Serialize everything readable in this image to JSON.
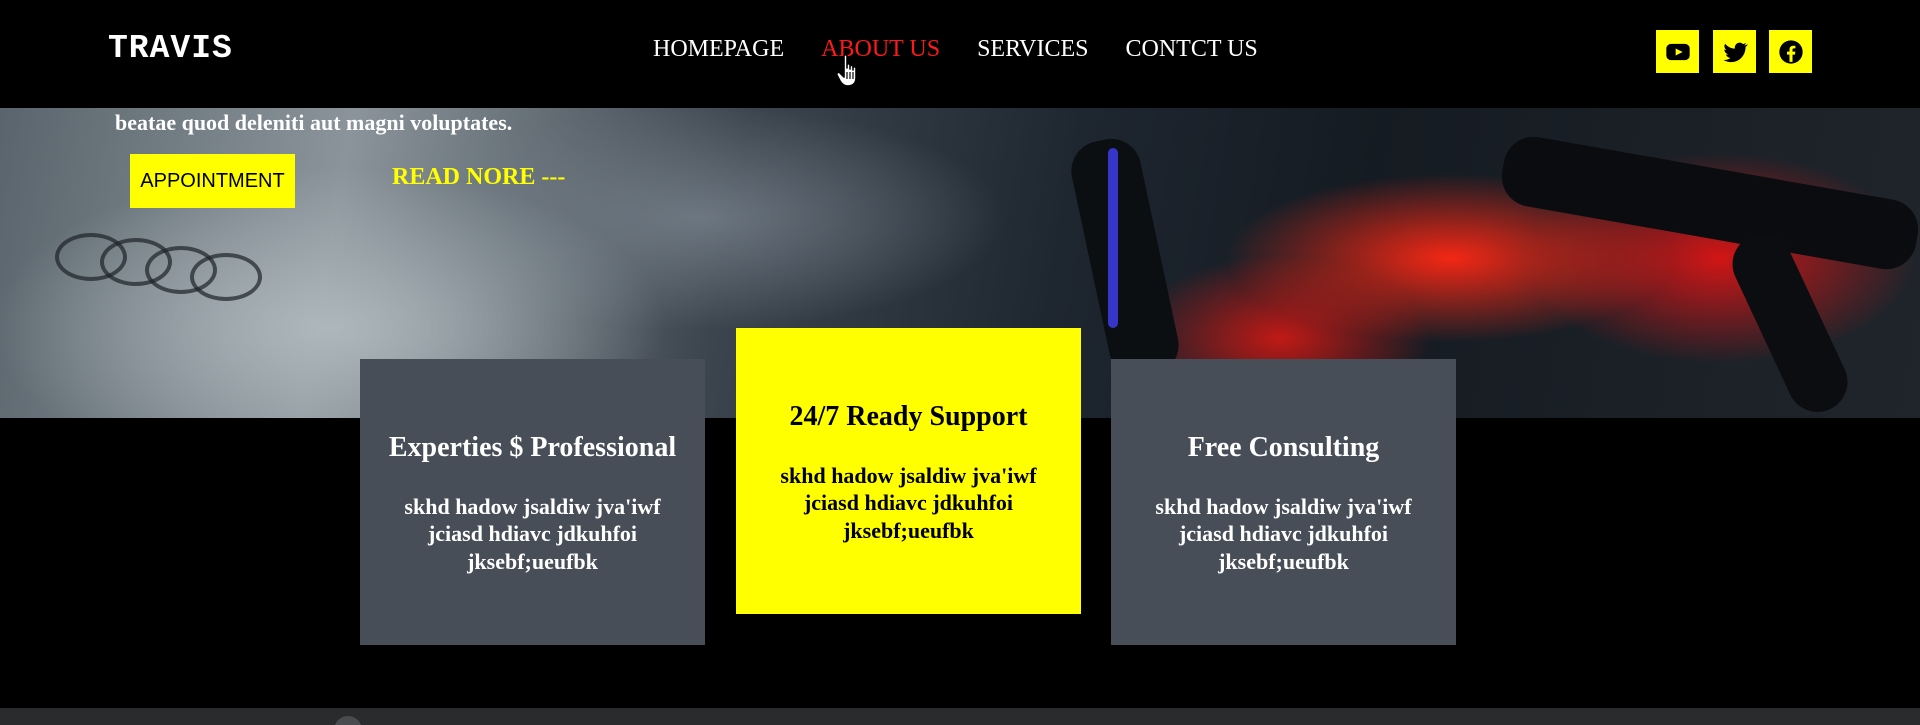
{
  "brand": {
    "logo": "TRAVIS"
  },
  "nav": {
    "items": [
      {
        "label": "HOMEPAGE",
        "active": false
      },
      {
        "label": "ABOUT US",
        "active": true
      },
      {
        "label": "SERVICES",
        "active": false
      },
      {
        "label": "CONTCT US",
        "active": false
      }
    ]
  },
  "social": [
    {
      "icon": "youtube-icon"
    },
    {
      "icon": "twitter-icon"
    },
    {
      "icon": "facebook-icon"
    }
  ],
  "hero": {
    "text": "beatae quod deleniti aut magni voluptates.",
    "appointment_label": "APPOINTMENT",
    "read_more_label": "READ NORE ---"
  },
  "cards": [
    {
      "title": "Experties $ Professional",
      "body": "skhd hadow jsaldiw jva'iwf jciasd hdiavc jdkuhfoi jksebf;ueufbk",
      "style": "gray"
    },
    {
      "title": "24/7 Ready Support",
      "body": "skhd hadow jsaldiw jva'iwf jciasd hdiavc jdkuhfoi jksebf;ueufbk",
      "style": "yellow"
    },
    {
      "title": "Free Consulting",
      "body": "skhd hadow jsaldiw jva'iwf jciasd hdiavc jdkuhfoi jksebf;ueufbk",
      "style": "gray"
    }
  ],
  "colors": {
    "accent": "#ffff00",
    "nav_active": "#ff1a1a",
    "card_gray": "#474e57",
    "background": "#000000"
  }
}
